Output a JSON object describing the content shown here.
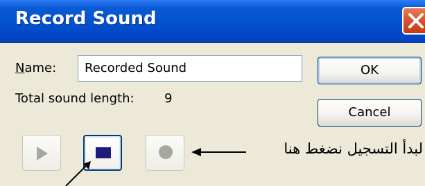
{
  "window": {
    "title": "Record Sound"
  },
  "fields": {
    "name_label_accel": "N",
    "name_label_rest": "ame:",
    "name_value": "Recorded Sound",
    "length_label": "Total sound length:",
    "length_value": "9"
  },
  "buttons": {
    "ok_label": "OK",
    "cancel_label": "Cancel"
  },
  "media": {
    "play_icon": "play-icon",
    "stop_icon": "stop-icon",
    "record_icon": "record-icon"
  },
  "annotation": {
    "text": "لبدأ التسجيل نضغط هنا"
  },
  "colors": {
    "titlebar": "#0453d0",
    "close_button": "#d5522e",
    "dialog_bg": "#ece9d8",
    "stop_glyph": "#1f1b7d"
  }
}
